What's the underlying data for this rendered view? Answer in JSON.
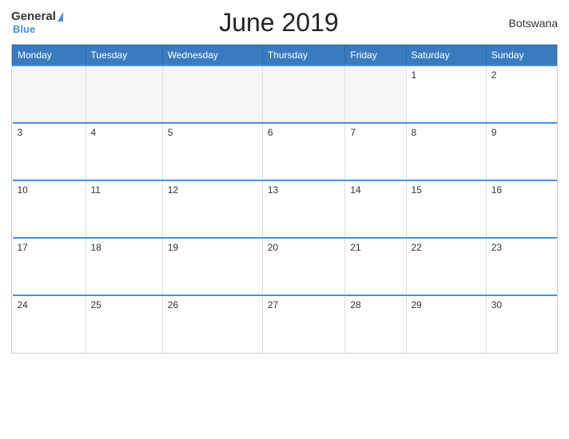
{
  "header": {
    "logo_general": "General",
    "logo_blue": "Blue",
    "title": "June 2019",
    "country": "Botswana"
  },
  "weekdays": [
    "Monday",
    "Tuesday",
    "Wednesday",
    "Thursday",
    "Friday",
    "Saturday",
    "Sunday"
  ],
  "weeks": [
    [
      null,
      null,
      null,
      null,
      null,
      "1",
      "2"
    ],
    [
      "3",
      "4",
      "5",
      "6",
      "7",
      "8",
      "9"
    ],
    [
      "10",
      "11",
      "12",
      "13",
      "14",
      "15",
      "16"
    ],
    [
      "17",
      "18",
      "19",
      "20",
      "21",
      "22",
      "23"
    ],
    [
      "24",
      "25",
      "26",
      "27",
      "28",
      "29",
      "30"
    ]
  ]
}
